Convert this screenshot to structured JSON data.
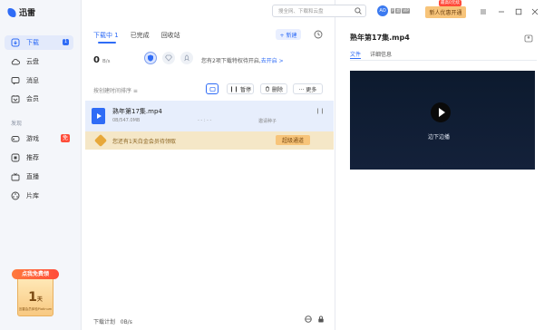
{
  "app": {
    "name": "迅雷"
  },
  "sidebar": {
    "items": [
      {
        "label": "下载",
        "icon": "download-icon",
        "badge": "1",
        "active": true
      },
      {
        "label": "云盘",
        "icon": "cloud-icon"
      },
      {
        "label": "消息",
        "icon": "message-icon"
      },
      {
        "label": "会员",
        "icon": "vip-icon"
      }
    ],
    "section_label": "发现",
    "discover": [
      {
        "label": "游戏",
        "icon": "game-icon",
        "badge": "免"
      },
      {
        "label": "推荐",
        "icon": "recommend-icon"
      },
      {
        "label": "直播",
        "icon": "live-icon"
      },
      {
        "label": "片库",
        "icon": "film-icon"
      }
    ],
    "promo": {
      "ribbon": "点我免费领",
      "day": "1",
      "unit": "天",
      "sub": "迅雷会员体验Platinum"
    }
  },
  "topbar": {
    "search_placeholder": "搜全网、下载和云盘",
    "avatar_text": "AO",
    "vip_tags": [
      "P",
      "超",
      "VIP"
    ],
    "renew_tag": "最高0元续",
    "renew_label": "新人优惠开通"
  },
  "download": {
    "tabs": [
      {
        "label": "下载中 1",
        "active": true
      },
      {
        "label": "已完成"
      },
      {
        "label": "回收站"
      }
    ],
    "new_label": "+ 新建",
    "speed": "0",
    "speed_unit": "B/s",
    "privilege_text": "您有2项下载特权待开启,",
    "privilege_link": "去开启 >",
    "sort_label": "按创建时间排序 ≡",
    "tools": {
      "pause": "暂停",
      "delete": "删除",
      "more": "··· 更多"
    },
    "task": {
      "name": "熟年第17集.mp4",
      "size": "0B/547.0MB",
      "dash": "- - : - -",
      "status": "邀请种子",
      "vip_text": "您还有1天白金会员待领取",
      "vip_button": "超级通道"
    },
    "footer": {
      "plan_label": "下载计划",
      "speed": "0B/s"
    }
  },
  "detail": {
    "title": "熟年第17集.mp4",
    "tabs": [
      {
        "label": "文件",
        "active": true
      },
      {
        "label": "详细信息"
      }
    ],
    "play_label": "边下边播"
  }
}
